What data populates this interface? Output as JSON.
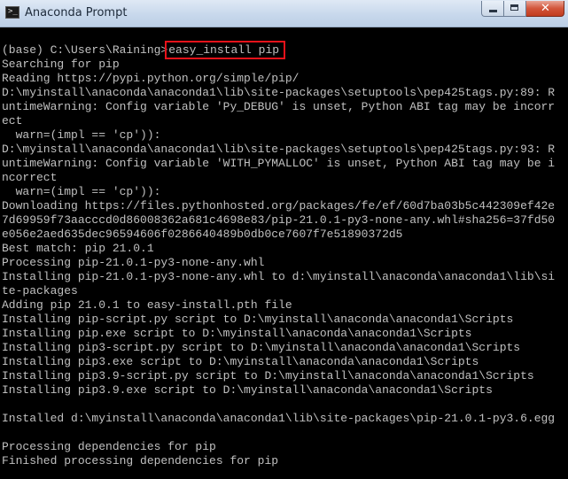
{
  "window": {
    "title": "Anaconda Prompt",
    "icon": "console-prompt-icon",
    "icon_glyph": ">_",
    "controls": {
      "minimize": "minimize-icon",
      "maximize": "maximize-icon",
      "close": "close-icon",
      "close_glyph": "✕"
    }
  },
  "console": {
    "prompt": "(base) C:\\Users\\Raining>",
    "command": "easy_install pip",
    "highlight_color": "#e8121a",
    "output": [
      "Searching for pip",
      "Reading https://pypi.python.org/simple/pip/",
      "D:\\myinstall\\anaconda\\anaconda1\\lib\\site-packages\\setuptools\\pep425tags.py:89: R",
      "untimeWarning: Config variable 'Py_DEBUG' is unset, Python ABI tag may be incorr",
      "ect",
      "  warn=(impl == 'cp')):",
      "D:\\myinstall\\anaconda\\anaconda1\\lib\\site-packages\\setuptools\\pep425tags.py:93: R",
      "untimeWarning: Config variable 'WITH_PYMALLOC' is unset, Python ABI tag may be i",
      "ncorrect",
      "  warn=(impl == 'cp')):",
      "Downloading https://files.pythonhosted.org/packages/fe/ef/60d7ba03b5c442309ef42e",
      "7d69959f73aacccd0d86008362a681c4698e83/pip-21.0.1-py3-none-any.whl#sha256=37fd50",
      "e056e2aed635dec96594606f0286640489b0db0ce7607f7e51890372d5",
      "Best match: pip 21.0.1",
      "Processing pip-21.0.1-py3-none-any.whl",
      "Installing pip-21.0.1-py3-none-any.whl to d:\\myinstall\\anaconda\\anaconda1\\lib\\si",
      "te-packages",
      "Adding pip 21.0.1 to easy-install.pth file",
      "Installing pip-script.py script to D:\\myinstall\\anaconda\\anaconda1\\Scripts",
      "Installing pip.exe script to D:\\myinstall\\anaconda\\anaconda1\\Scripts",
      "Installing pip3-script.py script to D:\\myinstall\\anaconda\\anaconda1\\Scripts",
      "Installing pip3.exe script to D:\\myinstall\\anaconda\\anaconda1\\Scripts",
      "Installing pip3.9-script.py script to D:\\myinstall\\anaconda\\anaconda1\\Scripts",
      "Installing pip3.9.exe script to D:\\myinstall\\anaconda\\anaconda1\\Scripts",
      "",
      "Installed d:\\myinstall\\anaconda\\anaconda1\\lib\\site-packages\\pip-21.0.1-py3.6.egg",
      "",
      "Processing dependencies for pip",
      "Finished processing dependencies for pip"
    ]
  }
}
